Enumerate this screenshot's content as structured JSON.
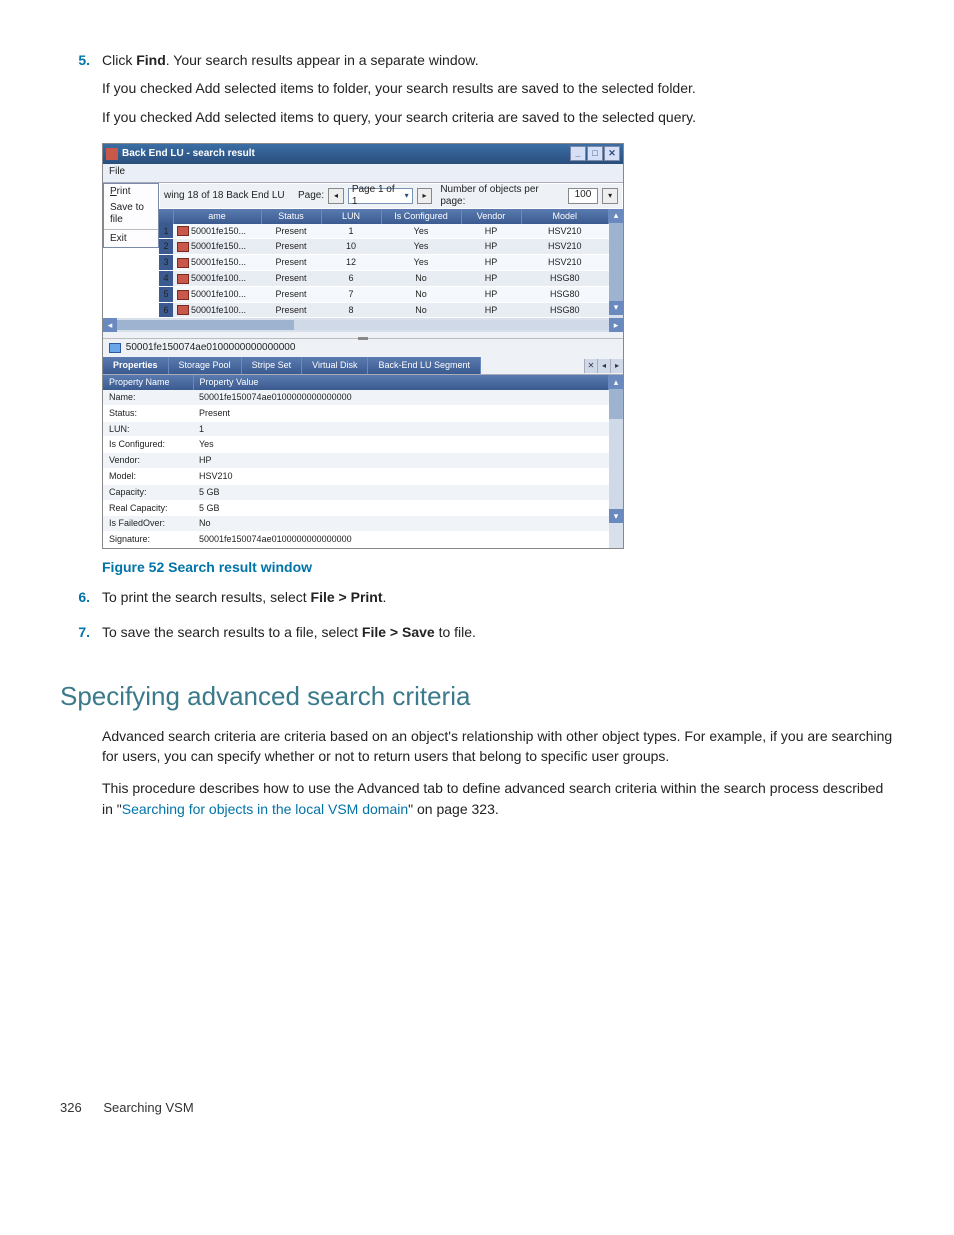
{
  "steps": {
    "s5": {
      "num": "5.",
      "line1_a": "Click ",
      "line1_b": "Find",
      "line1_c": ". Your search results appear in a separate window.",
      "line2": "If you checked Add selected items to folder, your search results are saved to the selected folder.",
      "line3": "If you checked Add selected items to query, your search criteria are saved to the selected query."
    },
    "s6": {
      "num": "6.",
      "a": "To print the search results, select ",
      "b": "File > Print",
      "c": "."
    },
    "s7": {
      "num": "7.",
      "a": "To save the search results to a file, select ",
      "b": "File > Save",
      "c": " to file."
    }
  },
  "figure_caption": "Figure 52 Search result window",
  "window": {
    "title": "Back End LU - search result",
    "menu_file": "File",
    "file_menu_items": {
      "print": "Print",
      "save": "Save to file",
      "exit": "Exit"
    },
    "status_left": "wing 18 of 18 Back End LU",
    "page_label": "Page:",
    "page_combo": "Page 1 of 1",
    "objects_label": "Number of objects per page:",
    "objects_value": "100",
    "columns": {
      "name": "ame",
      "status": "Status",
      "lun": "LUN",
      "isconf": "Is Configured",
      "vendor": "Vendor",
      "model": "Model"
    },
    "rows": [
      {
        "n": "1",
        "name": "50001fe150...",
        "status": "Present",
        "lun": "1",
        "conf": "Yes",
        "vendor": "HP",
        "model": "HSV210"
      },
      {
        "n": "2",
        "name": "50001fe150...",
        "status": "Present",
        "lun": "10",
        "conf": "Yes",
        "vendor": "HP",
        "model": "HSV210"
      },
      {
        "n": "3",
        "name": "50001fe150...",
        "status": "Present",
        "lun": "12",
        "conf": "Yes",
        "vendor": "HP",
        "model": "HSV210"
      },
      {
        "n": "4",
        "name": "50001fe100...",
        "status": "Present",
        "lun": "6",
        "conf": "No",
        "vendor": "HP",
        "model": "HSG80"
      },
      {
        "n": "5",
        "name": "50001fe100...",
        "status": "Present",
        "lun": "7",
        "conf": "No",
        "vendor": "HP",
        "model": "HSG80"
      },
      {
        "n": "6",
        "name": "50001fe100...",
        "status": "Present",
        "lun": "8",
        "conf": "No",
        "vendor": "HP",
        "model": "HSG80"
      }
    ],
    "selected_object": "50001fe150074ae0100000000000000",
    "tabs": {
      "prop": "Properties",
      "pool": "Storage Pool",
      "stripe": "Stripe Set",
      "vdisk": "Virtual Disk",
      "seg": "Back-End LU Segment"
    },
    "prop_headers": {
      "name": "Property Name",
      "value": "Property Value"
    },
    "props": [
      {
        "k": "Name:",
        "v": "50001fe150074ae0100000000000000"
      },
      {
        "k": "Status:",
        "v": "Present"
      },
      {
        "k": "LUN:",
        "v": "1"
      },
      {
        "k": "Is Configured:",
        "v": "Yes"
      },
      {
        "k": "Vendor:",
        "v": "HP"
      },
      {
        "k": "Model:",
        "v": "HSV210"
      },
      {
        "k": "Capacity:",
        "v": "5   GB"
      },
      {
        "k": "Real Capacity:",
        "v": "5   GB"
      },
      {
        "k": "Is FailedOver:",
        "v": "No"
      },
      {
        "k": "Signature:",
        "v": "50001fe150074ae0100000000000000"
      }
    ]
  },
  "section_heading": "Specifying advanced search criteria",
  "para1": "Advanced search criteria are criteria based on an object's relationship with other object types. For example, if you are searching for users, you can specify whether or not to return users that belong to specific user groups.",
  "para2_a": "This procedure describes how to use the Advanced tab to define advanced search criteria within the search process described in \"",
  "para2_link": "Searching for objects in the local VSM domain",
  "para2_b": "\" on page 323.",
  "footer": {
    "page": "326",
    "chapter": "Searching VSM"
  }
}
